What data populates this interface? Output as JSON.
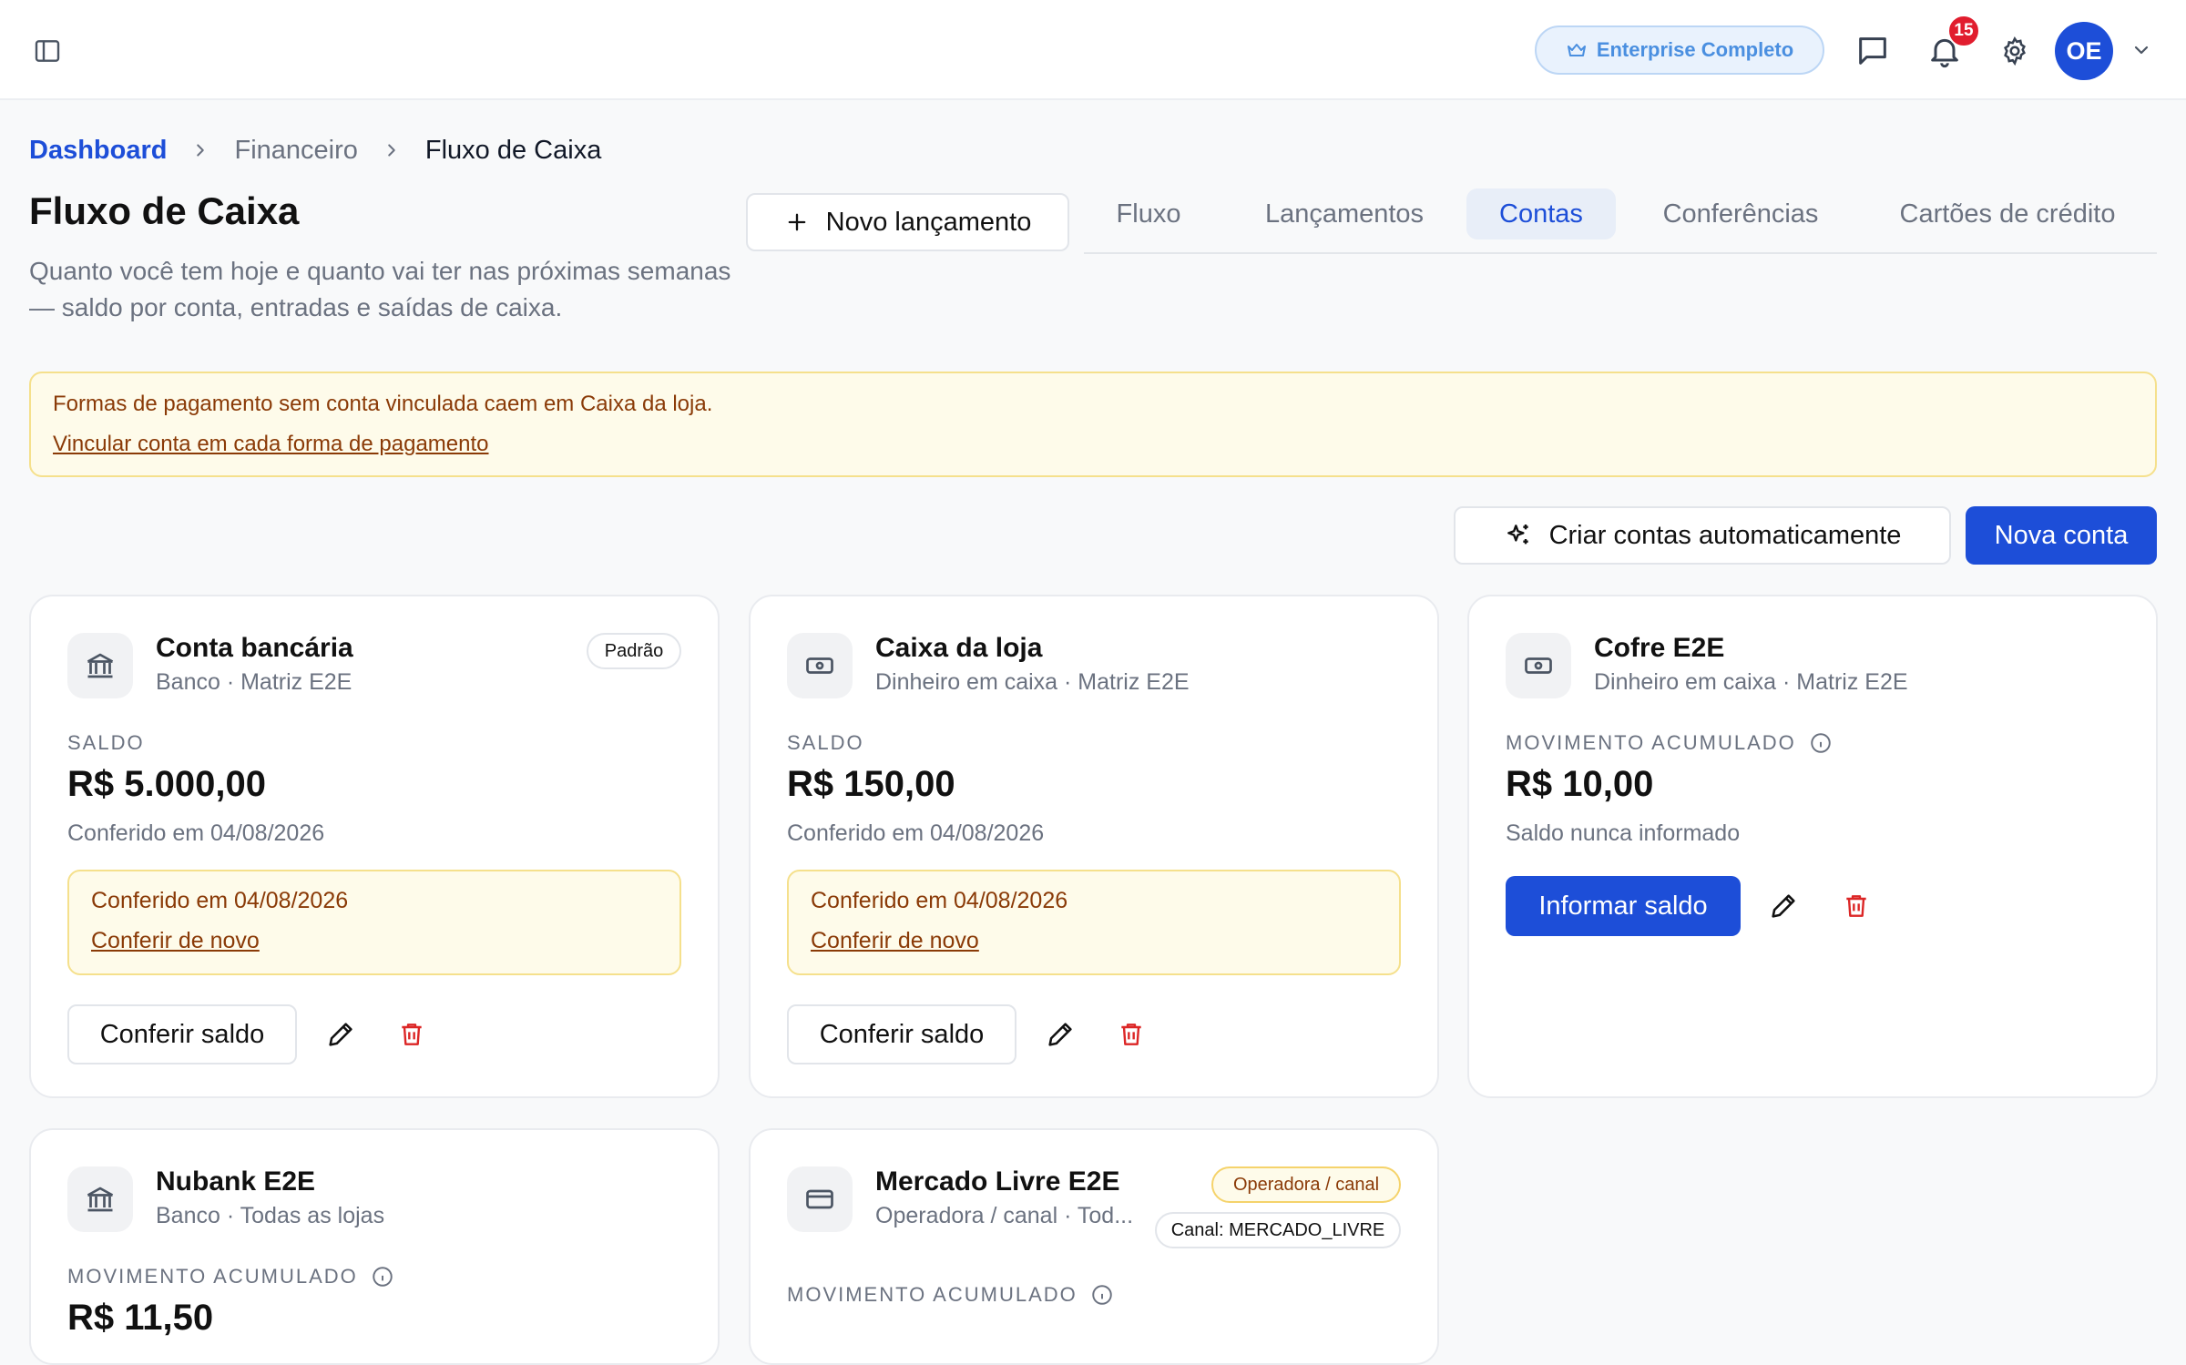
{
  "topbar": {
    "plan_label": "Enterprise Completo",
    "notification_count": "15",
    "avatar_initials": "OE"
  },
  "breadcrumb": {
    "items": [
      "Dashboard",
      "Financeiro",
      "Fluxo de Caixa"
    ]
  },
  "page": {
    "title": "Fluxo de Caixa",
    "subtitle": "Quanto você tem hoje e quanto vai ter nas próximas semanas — saldo por conta, entradas e saídas de caixa.",
    "new_entry_label": "Novo lançamento"
  },
  "tabs": [
    {
      "label": "Fluxo",
      "active": false
    },
    {
      "label": "Lançamentos",
      "active": false
    },
    {
      "label": "Contas",
      "active": true
    },
    {
      "label": "Conferências",
      "active": false
    },
    {
      "label": "Cartões de crédito",
      "active": false
    }
  ],
  "alert": {
    "message": "Formas de pagamento sem conta vinculada caem em Caixa da loja.",
    "link": "Vincular conta em cada forma de pagamento"
  },
  "actions": {
    "auto_create_label": "Criar contas automaticamente",
    "new_account_label": "Nova conta"
  },
  "accounts": [
    {
      "name": "Conta bancária",
      "meta": "Banco · Matriz E2E",
      "badge": "Padrão",
      "label": "SALDO",
      "amount": "R$ 5.000,00",
      "note": "Conferido em 04/08/2026",
      "confirm_text": "Conferido em 04/08/2026",
      "confirm_link": "Conferir de novo",
      "check_label": "Conferir saldo",
      "icon": "bank-icon"
    },
    {
      "name": "Caixa da loja",
      "meta": "Dinheiro em caixa · Matriz E2E",
      "label": "SALDO",
      "amount": "R$ 150,00",
      "note": "Conferido em 04/08/2026",
      "confirm_text": "Conferido em 04/08/2026",
      "confirm_link": "Conferir de novo",
      "check_label": "Conferir saldo",
      "icon": "cash-icon"
    },
    {
      "name": "Cofre E2E",
      "meta": "Dinheiro em caixa · Matriz E2E",
      "label": "MOVIMENTO ACUMULADO",
      "amount": "R$ 10,00",
      "note": "Saldo nunca informado",
      "inform_label": "Informar saldo",
      "icon": "cash-icon"
    },
    {
      "name": "Nubank E2E",
      "meta": "Banco · Todas as lojas",
      "label": "MOVIMENTO ACUMULADO",
      "amount": "R$ 11,50",
      "icon": "bank-icon"
    },
    {
      "name": "Mercado Livre E2E",
      "meta": "Operadora / canal · Tod...",
      "badge": "Operadora / canal",
      "channel": "Canal: MERCADO_LIVRE",
      "label": "MOVIMENTO ACUMULADO",
      "icon": "card-icon"
    }
  ]
}
